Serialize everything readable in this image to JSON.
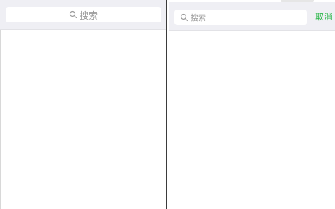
{
  "left_screen": {
    "search": {
      "placeholder": "搜索"
    }
  },
  "right_screen": {
    "search": {
      "placeholder": "搜索"
    },
    "cancel_label": "取消"
  },
  "colors": {
    "search_bar_background": "#efeff4",
    "accent_green": "#2db74b",
    "placeholder_text": "#9b9b9b"
  },
  "icons": [
    "search-icon"
  ]
}
